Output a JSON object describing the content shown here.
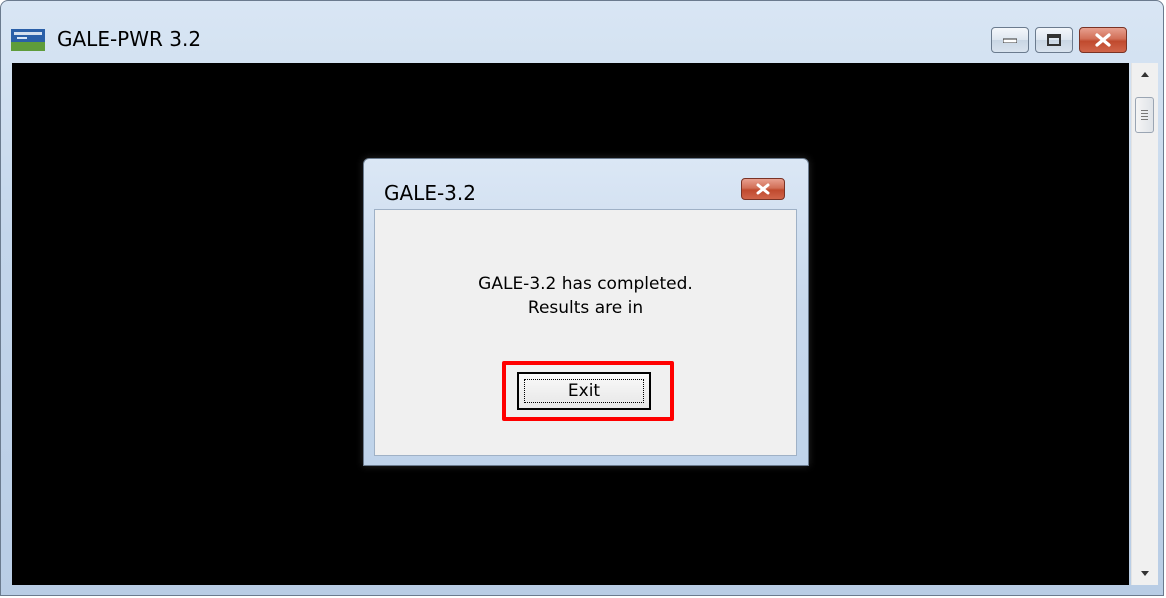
{
  "window": {
    "title": "GALE-PWR 3.2",
    "icon": "app-icon"
  },
  "caption_buttons": {
    "minimize_icon": "minimize-icon",
    "maximize_icon": "maximize-icon",
    "close_icon": "close-icon"
  },
  "dialog": {
    "title": "GALE-3.2",
    "message_line1": "GALE-3.2 has completed.",
    "message_line2": "Results are in",
    "exit_label": "Exit",
    "highlight_color": "#ff0000"
  },
  "scrollbar": {
    "up_icon": "scroll-up-arrow-icon",
    "down_icon": "scroll-down-arrow-icon"
  }
}
